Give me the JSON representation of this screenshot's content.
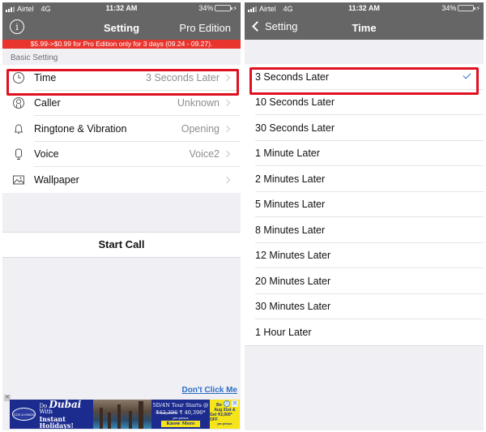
{
  "colors": {
    "navbar_bg": "#666666",
    "promo_bg": "#e8352e",
    "highlight": "#e01020",
    "check": "#2f72d4",
    "link": "#2c6ec4",
    "background": "#efeff4"
  },
  "status_bar": {
    "carrier": "Airtel",
    "network": "4G",
    "time": "11:32 AM",
    "battery_percent_label": "34%",
    "battery_level": 0.34,
    "charging_icon": "bolt-icon"
  },
  "left_screen": {
    "navbar": {
      "info_icon": "info-icon",
      "info_glyph": "i",
      "title": "Setting",
      "right_button": "Pro Edition"
    },
    "promo_banner": "$5.99->$0.99 for Pro Edition only for 3 days (09.24 - 09.27).",
    "section_header": "Basic Setting",
    "settings": [
      {
        "icon": "clock-icon",
        "label": "Time",
        "value": "3 Seconds Later",
        "highlighted": true
      },
      {
        "icon": "caller-icon",
        "label": "Caller",
        "value": "Unknown"
      },
      {
        "icon": "bell-icon",
        "label": "Ringtone & Vibration",
        "value": "Opening"
      },
      {
        "icon": "microphone-icon",
        "label": "Voice",
        "value": "Voice2"
      },
      {
        "icon": "image-icon",
        "label": "Wallpaper",
        "value": ""
      }
    ],
    "start_call": "Start Call",
    "dont_click_link": "Don't Click Me",
    "ad": {
      "close_glyph": "✕",
      "logo_text": "COX & KINGS",
      "headline_prefix": "Do",
      "headline_city": "Dubai",
      "headline_suffix": "With",
      "headline_line2": "Instant Holidays!",
      "offer_line1": "5D/4N Tour Starts @",
      "offer_old_price": "₹42,396",
      "offer_new_price": "₹ 40,396*",
      "offer_per_person": "per person",
      "cta": "Know More",
      "right_line1": "Bo",
      "right_line2": "Aug 31st &",
      "right_line3": "Get ₹2,000* OFF",
      "right_line4": "per person",
      "ad_info_glyph": "i",
      "ad_close_glyph": "✕"
    }
  },
  "right_screen": {
    "navbar": {
      "back_label": "Setting",
      "title": "Time"
    },
    "options": [
      {
        "label": "3 Seconds Later",
        "selected": true
      },
      {
        "label": "10 Seconds Later",
        "selected": false
      },
      {
        "label": "30 Seconds Later",
        "selected": false
      },
      {
        "label": "1 Minute Later",
        "selected": false
      },
      {
        "label": "2 Minutes Later",
        "selected": false
      },
      {
        "label": "5 Minutes Later",
        "selected": false
      },
      {
        "label": "8 Minutes Later",
        "selected": false
      },
      {
        "label": "12 Minutes Later",
        "selected": false
      },
      {
        "label": "20 Minutes Later",
        "selected": false
      },
      {
        "label": "30 Minutes Later",
        "selected": false
      },
      {
        "label": "1 Hour Later",
        "selected": false
      }
    ]
  }
}
